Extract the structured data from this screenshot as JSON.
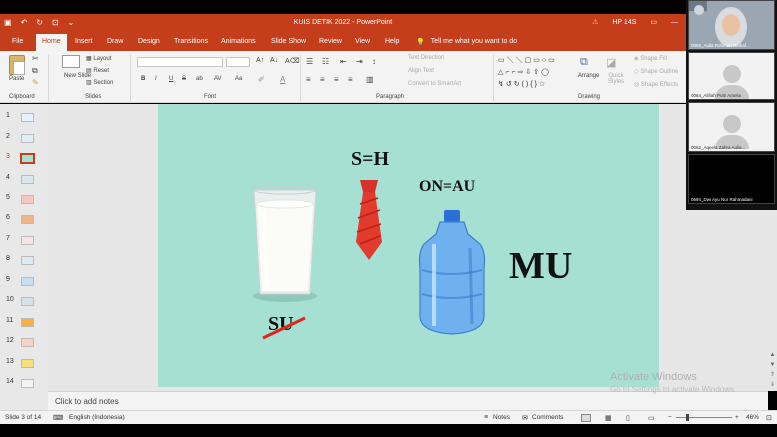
{
  "window": {
    "title": "KUIS DETIK 2022  -  PowerPoint",
    "user_name": "HP 14S"
  },
  "tabs": [
    "File",
    "Home",
    "Insert",
    "Draw",
    "Design",
    "Transitions",
    "Animations",
    "Slide Show",
    "Review",
    "View",
    "Help"
  ],
  "active_tab": "Home",
  "tell_me": "Tell me what you want to do",
  "ribbon": {
    "clipboard": {
      "label": "Clipboard",
      "paste": "Paste"
    },
    "slides": {
      "label": "Slides",
      "new_slide": "New Slide",
      "layout": "Layout",
      "reset": "Reset",
      "section": "Section"
    },
    "font": {
      "label": "Font",
      "bold": "B",
      "italic": "I",
      "underline": "U",
      "strike": "S",
      "shadow": "ab",
      "spacing": "AV",
      "case": "Aa"
    },
    "paragraph": {
      "label": "Paragraph",
      "text_direction": "Text Direction",
      "align_text": "Align Text",
      "smartart": "Convert to SmartArt"
    },
    "drawing": {
      "label": "Drawing",
      "arrange": "Arrange",
      "quick_styles": "Quick Styles",
      "shape_fill": "Shape Fill",
      "shape_outline": "Shape Outline",
      "shape_effects": "Shape Effects"
    }
  },
  "slide_numbers": [
    "1",
    "2",
    "3",
    "4",
    "5",
    "6",
    "7",
    "8",
    "9",
    "10",
    "11",
    "12",
    "13",
    "14"
  ],
  "current_slide": 3,
  "slide": {
    "sh": "S=H",
    "onau": "ON=AU",
    "mu": "MU",
    "su": "SU",
    "background": "#a6e0d3"
  },
  "notes_placeholder": "Click to add notes",
  "status": {
    "slide_of": "Slide 3 of 14",
    "language": "English (Indonesia)",
    "notes": "Notes",
    "comments": "Comments",
    "zoom": "46%"
  },
  "watermark": {
    "line1": "Activate Windows",
    "line2": "Go to Settings to activate Windows."
  },
  "participants": [
    "0068_Aulia Rohmah Reihaf...",
    "0064_Alifiah Putri Amelia",
    "0062_Aqeela Zahra Aulia...",
    "0694_Dwi Ayu Nur Rahmadani"
  ],
  "colors": {
    "accent": "#c43e1c",
    "tie": "#e23b2e",
    "ribbon_bg": "#f3f3f3"
  }
}
